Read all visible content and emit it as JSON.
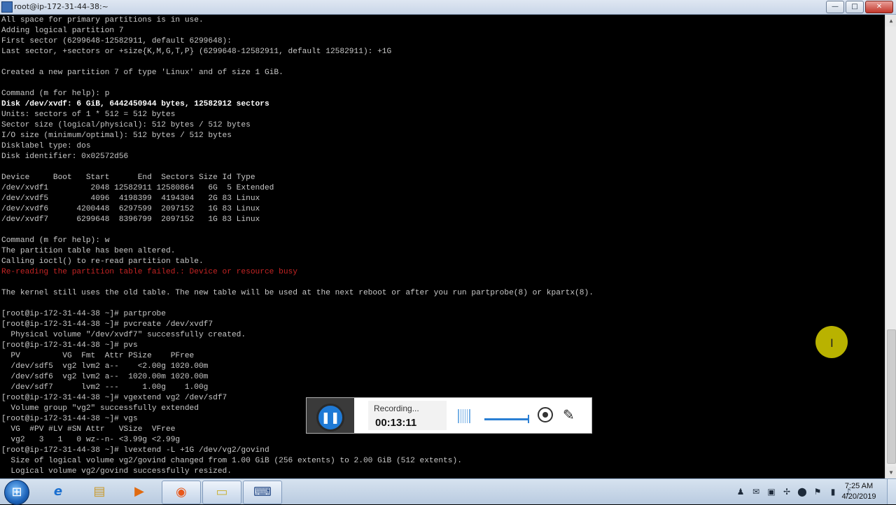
{
  "window": {
    "title": "root@ip-172-31-44-38:~"
  },
  "window_controls": {
    "minimize": "—",
    "maximize": "□",
    "close": "✕"
  },
  "terminal": {
    "lines": [
      "All space for primary partitions is in use.",
      "Adding logical partition 7",
      "First sector (6299648-12582911, default 6299648):",
      "Last sector, +sectors or +size{K,M,G,T,P} (6299648-12582911, default 12582911): +1G",
      "",
      "Created a new partition 7 of type 'Linux' and of size 1 GiB.",
      "",
      "Command (m for help): p",
      "Disk /dev/xvdf: 6 GiB, 6442450944 bytes, 12582912 sectors",
      "Units: sectors of 1 * 512 = 512 bytes",
      "Sector size (logical/physical): 512 bytes / 512 bytes",
      "I/O size (minimum/optimal): 512 bytes / 512 bytes",
      "Disklabel type: dos",
      "Disk identifier: 0x02572d56",
      "",
      "Device     Boot   Start      End  Sectors Size Id Type",
      "/dev/xvdf1         2048 12582911 12580864   6G  5 Extended",
      "/dev/xvdf5         4096  4198399  4194304   2G 83 Linux",
      "/dev/xvdf6      4200448  6297599  2097152   1G 83 Linux",
      "/dev/xvdf7      6299648  8396799  2097152   1G 83 Linux",
      "",
      "Command (m for help): w",
      "The partition table has been altered.",
      "Calling ioctl() to re-read partition table.",
      "Re-reading the partition table failed.: Device or resource busy",
      "",
      "The kernel still uses the old table. The new table will be used at the next reboot or after you run partprobe(8) or kpartx(8).",
      "",
      "[root@ip-172-31-44-38 ~]# partprobe",
      "[root@ip-172-31-44-38 ~]# pvcreate /dev/xvdf7",
      "  Physical volume \"/dev/xvdf7\" successfully created.",
      "[root@ip-172-31-44-38 ~]# pvs",
      "  PV         VG  Fmt  Attr PSize    PFree",
      "  /dev/sdf5  vg2 lvm2 a--    <2.00g 1020.00m",
      "  /dev/sdf6  vg2 lvm2 a--  1020.00m 1020.00m",
      "  /dev/sdf7      lvm2 ---     1.00g    1.00g",
      "[root@ip-172-31-44-38 ~]# vgextend vg2 /dev/sdf7",
      "  Volume group \"vg2\" successfully extended",
      "[root@ip-172-31-44-38 ~]# vgs",
      "  VG  #PV #LV #SN Attr   VSize  VFree",
      "  vg2   3   1   0 wz--n- <3.99g <2.99g",
      "[root@ip-172-31-44-38 ~]# lvextend -L +1G /dev/vg2/govind",
      "  Size of logical volume vg2/govind changed from 1.00 GiB (256 extents) to 2.00 GiB (512 extents).",
      "  Logical volume vg2/govind successfully resized."
    ],
    "bold_line_index": 8,
    "error_line_index": 24,
    "text_color": "#c8c8c8",
    "error_color": "#c52424"
  },
  "recorder": {
    "status": "Recording...",
    "timer": "00:13:11",
    "pause_glyph": "❚❚",
    "pen_glyph": "✎"
  },
  "taskbar": {
    "apps": [
      {
        "name": "internet-explorer",
        "glyph": "e"
      },
      {
        "name": "file-explorer",
        "glyph": "▤"
      },
      {
        "name": "media-player",
        "glyph": "▶"
      },
      {
        "name": "firefox",
        "glyph": "◉"
      },
      {
        "name": "sticky-notes",
        "glyph": "▭"
      },
      {
        "name": "putty",
        "glyph": "⌨"
      }
    ],
    "clock_time": "7:25 AM",
    "clock_date": "4/20/2019"
  }
}
